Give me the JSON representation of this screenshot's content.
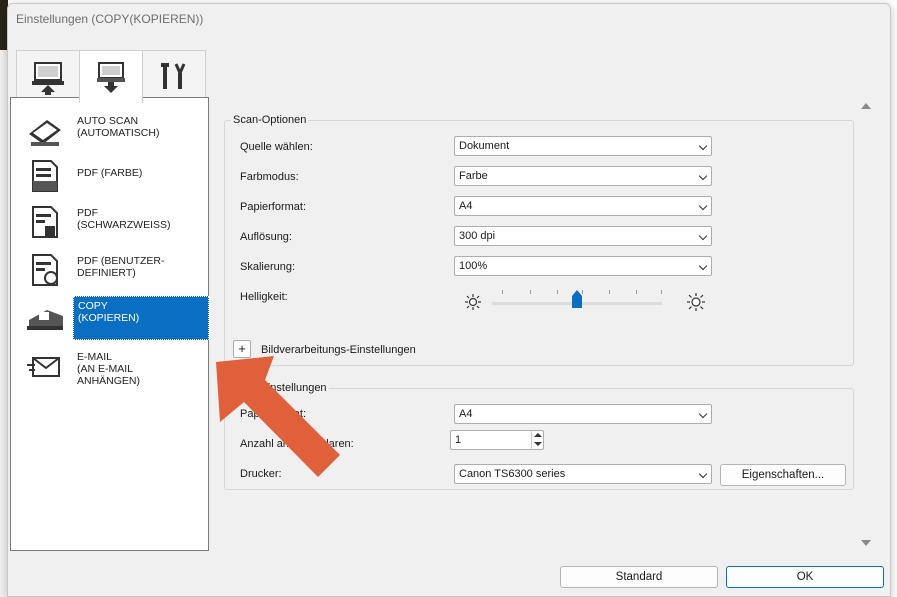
{
  "window": {
    "title": "Einstellungen (COPY(KOPIEREN))"
  },
  "tabs": [
    {
      "icon": "computer-scan-icon",
      "selected": false
    },
    {
      "icon": "scanner-to-pc-icon",
      "selected": true
    },
    {
      "icon": "tools-icon",
      "selected": false
    }
  ],
  "modes": [
    {
      "label": "AUTO SCAN\n(AUTOMATISCH)",
      "icon": "auto-scan-icon",
      "selected": false
    },
    {
      "label": "PDF (FARBE)",
      "icon": "pdf-color-icon",
      "selected": false
    },
    {
      "label": "PDF\n(SCHWARZWEISS)",
      "icon": "pdf-bw-icon",
      "selected": false
    },
    {
      "label": "PDF (BENUTZER-\nDEFINIERT)",
      "icon": "pdf-custom-icon",
      "selected": false
    },
    {
      "label": "COPY\n(KOPIEREN)",
      "icon": "copy-icon",
      "selected": true
    },
    {
      "label": "E-MAIL\n(AN E-MAIL\nANHÄNGEN)",
      "icon": "email-icon",
      "selected": false
    }
  ],
  "scan_options": {
    "title": "Scan-Optionen",
    "source_label": "Quelle wählen:",
    "source_value": "Dokument",
    "color_mode_label": "Farbmodus:",
    "color_mode_value": "Farbe",
    "paper_size_label": "Papierformat:",
    "paper_size_value": "A4",
    "resolution_label": "Auflösung:",
    "resolution_value": "300 dpi",
    "scaling_label": "Skalierung:",
    "scaling_value": "100%",
    "brightness_label": "Helligkeit:",
    "brightness_level": 0.5,
    "image_processing_label": "Bildverarbeitungs-Einstellungen"
  },
  "print_settings": {
    "title": "Druckeinstellungen",
    "paper_format_label": "Papierformat:",
    "paper_format_value": "A4",
    "copies_label": "Anzahl an Exemplaren:",
    "copies_value": "1",
    "printer_label": "Drucker:",
    "printer_value": "Canon TS6300 series",
    "properties_button": "Eigenschaften..."
  },
  "footer": {
    "standard_button": "Standard",
    "ok_button": "OK"
  },
  "colors": {
    "selection": "#0a6fc2",
    "arrow": "#e0603c"
  }
}
